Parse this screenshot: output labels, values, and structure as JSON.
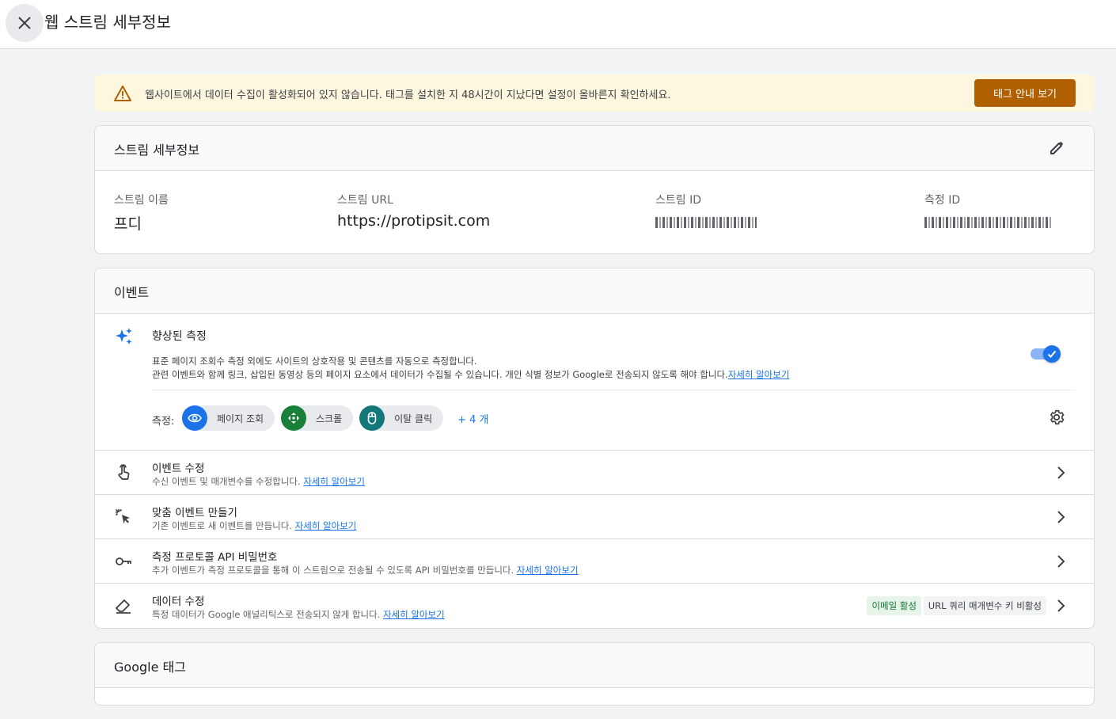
{
  "topbar": {
    "title": "웹 스트림 세부정보"
  },
  "banner": {
    "message": "웹사이트에서 데이터 수집이 활성화되어 있지 않습니다. 태그를 설치한 지 48시간이 지났다면 설정이 올바른지 확인하세요.",
    "button_label": "태그 안내 보기",
    "color": "#b06000"
  },
  "stream_details": {
    "title": "스트림 세부정보",
    "fields": [
      {
        "label": "스트림 이름",
        "value": "프디"
      },
      {
        "label": "스트림 URL",
        "value": "https://protipsit.com"
      },
      {
        "label": "스트림 ID",
        "value": ""
      },
      {
        "label": "측정 ID",
        "value": ""
      }
    ]
  },
  "events": {
    "title": "이벤트",
    "enhanced": {
      "title": "향상된 측정",
      "desc_line1": "표준 페이지 조회수 측정 외에도 사이트의 상호작용 및 콘텐츠를 자동으로 측정합니다.",
      "desc_line2": "관련 이벤트와 함께 링크, 삽입된 동영상 등의 페이지 요소에서 데이터가 수집될 수 있습니다. 개인 식별 정보가 Google로 전송되지 않도록 해야 합니다.",
      "learn_more": "자세히 알아보기",
      "enabled": true,
      "measure_label": "측정:",
      "chips": [
        {
          "label": "페이지 조회",
          "icon": "eye-icon",
          "color": "#1a73e8"
        },
        {
          "label": "스크롤",
          "icon": "scroll-icon",
          "color": "#188038"
        },
        {
          "label": "이탈 클릭",
          "icon": "mouse-icon",
          "color": "#12787a"
        }
      ],
      "more": "+ 4 개"
    },
    "rows": [
      {
        "title": "이벤트 수정",
        "desc": "수신 이벤트 및 매개변수를 수정합니다.",
        "link": "자세히 알아보기",
        "icon": "touch-icon"
      },
      {
        "title": "맞춤 이벤트 만들기",
        "desc": "기존 이벤트로 새 이벤트를 만듭니다.",
        "link": "자세히 알아보기",
        "icon": "click-sparkle-icon"
      },
      {
        "title": "측정 프로토콜 API 비밀번호",
        "desc": "추가 이벤트가 측정 프로토콜을 통해 이 스트림으로 전송될 수 있도록 API 비밀번호를 만듭니다.",
        "link": "자세히 알아보기",
        "icon": "key-icon"
      },
      {
        "title": "데이터 수정",
        "desc": "특정 데이터가 Google 애널리틱스로 전송되지 않게 합니다.",
        "link": "자세히 알아보기",
        "icon": "eraser-icon",
        "badge_green": "이메일 활성",
        "badge_grey": "URL 쿼리 매개변수 키 비활성"
      }
    ]
  },
  "google_tag": {
    "title": "Google 태그"
  }
}
